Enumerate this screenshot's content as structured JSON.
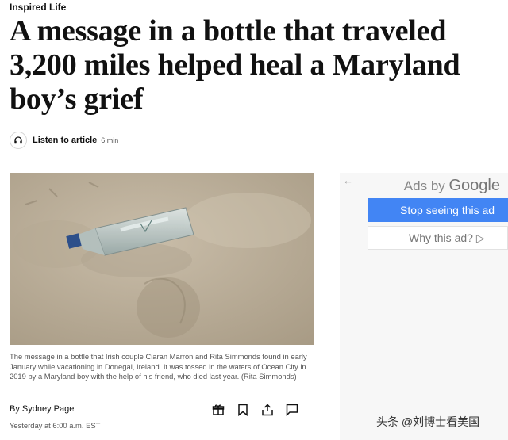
{
  "article": {
    "kicker": "Inspired Life",
    "headline": "A message in a bottle that traveled 3,200 miles helped heal a Maryland boy’s grief",
    "listen": {
      "label": "Listen to article",
      "duration": "6 min"
    },
    "photo": {
      "icon": "message-bottle-on-sand"
    },
    "caption": "The message in a bottle that Irish couple Ciaran Marron and Rita Simmonds found in early January while vacationing in Donegal, Ireland. It was tossed in the waters of Ocean City in 2019 by a Maryland boy with the help of his friend, who died last year. (Rita Simmonds)",
    "byline": {
      "prefix": "By ",
      "author": "Sydney Page"
    },
    "timestamp": "Yesterday at 6:00 a.m. EST",
    "actions": [
      "gift-icon",
      "bookmark-icon",
      "share-icon",
      "comment-icon"
    ]
  },
  "ad": {
    "back": "←",
    "title_prefix": "Ads by ",
    "title_brand": "Google",
    "stop_label": "Stop seeing this ad",
    "why_label": "Why this ad? ▷"
  },
  "watermark": "头条 @刘博士看美国",
  "colors": {
    "ad_button": "#4285f4",
    "ad_panel": "#f7f7f7",
    "caption": "#555555"
  }
}
